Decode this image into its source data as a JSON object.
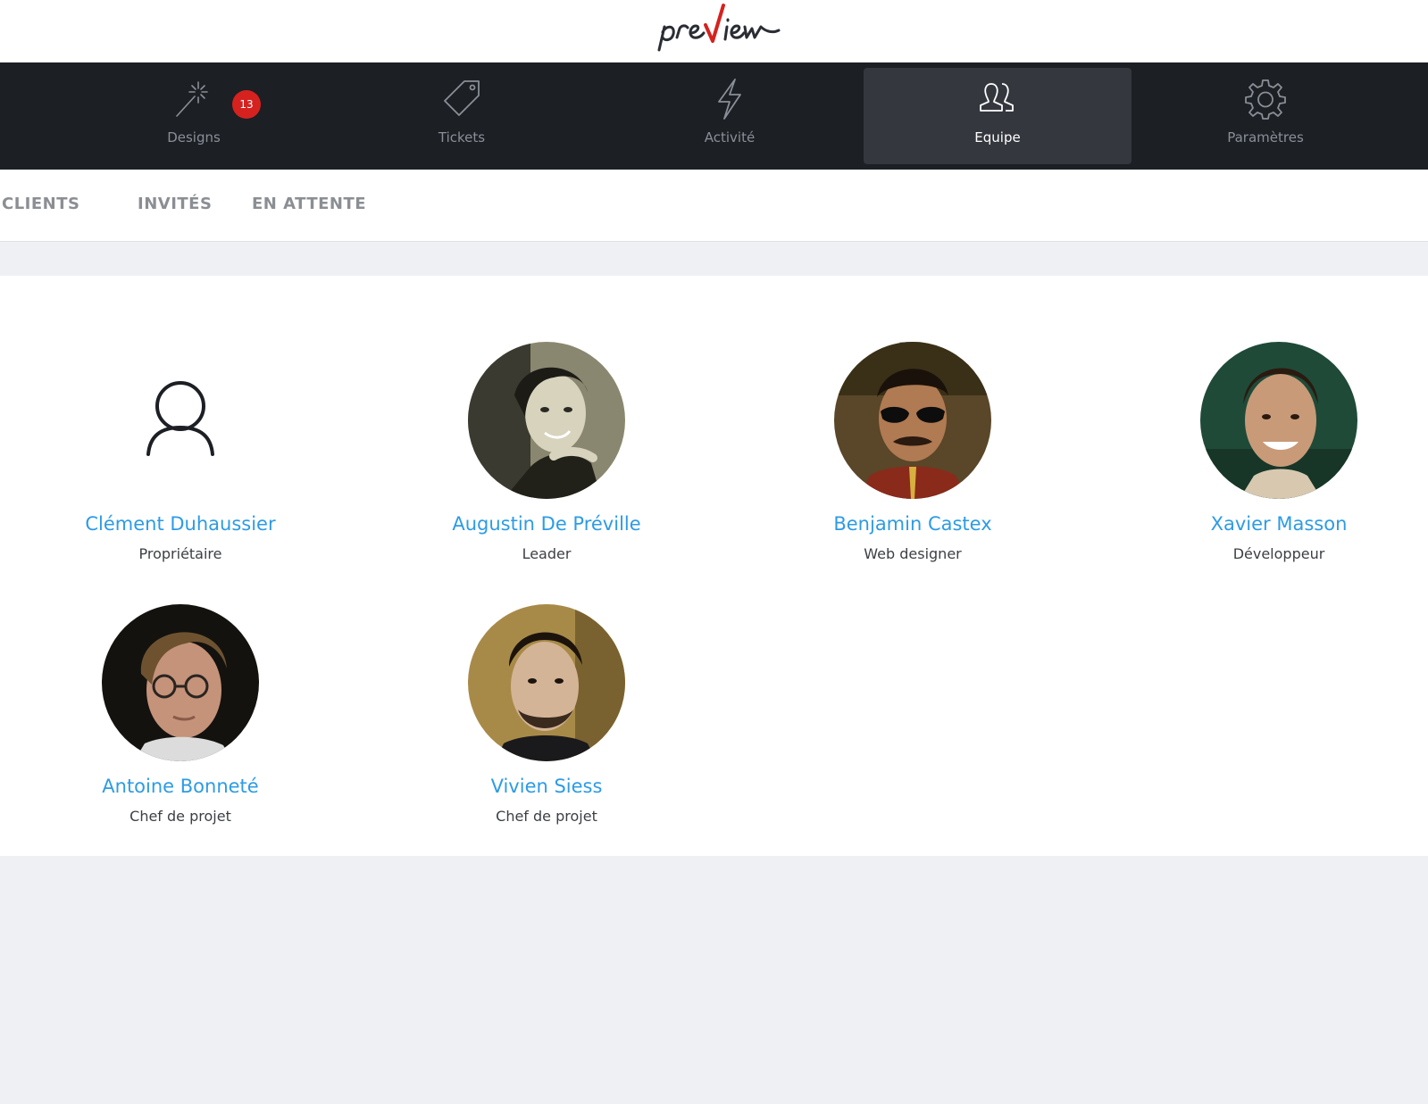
{
  "app": {
    "logo_text": "preview"
  },
  "nav": {
    "items": [
      {
        "label": "Designs",
        "icon": "magic-wand-icon"
      },
      {
        "label": "Tickets",
        "icon": "tag-icon"
      },
      {
        "label": "Activité",
        "icon": "lightning-icon"
      },
      {
        "label": "Equipe",
        "icon": "team-icon"
      },
      {
        "label": "Paramètres",
        "icon": "gear-icon"
      }
    ],
    "active": "Equipe",
    "designs_badge": "13"
  },
  "subtabs": [
    {
      "label": "CLIENTS"
    },
    {
      "label": "INVITÉS"
    },
    {
      "label": "EN ATTENTE"
    }
  ],
  "members": [
    {
      "name": "Clément Duhaussier",
      "role": "Propriétaire",
      "avatar": "default-user-icon"
    },
    {
      "name": "Augustin De Préville",
      "role": "Leader",
      "avatar": "photo"
    },
    {
      "name": "Benjamin Castex",
      "role": "Web designer",
      "avatar": "photo"
    },
    {
      "name": "Xavier Masson",
      "role": "Développeur",
      "avatar": "photo"
    },
    {
      "name": "Antoine Bonneté",
      "role": "Chef de projet",
      "avatar": "photo"
    },
    {
      "name": "Vivien Siess",
      "role": "Chef de projet",
      "avatar": "photo"
    }
  ],
  "colors": {
    "nav_bg": "#1c1f24",
    "nav_active_bg": "#34373d",
    "link_blue": "#2d9be5",
    "badge_red": "#d5221f",
    "logo_red": "#d5221f",
    "page_bg": "#eef0f4"
  }
}
